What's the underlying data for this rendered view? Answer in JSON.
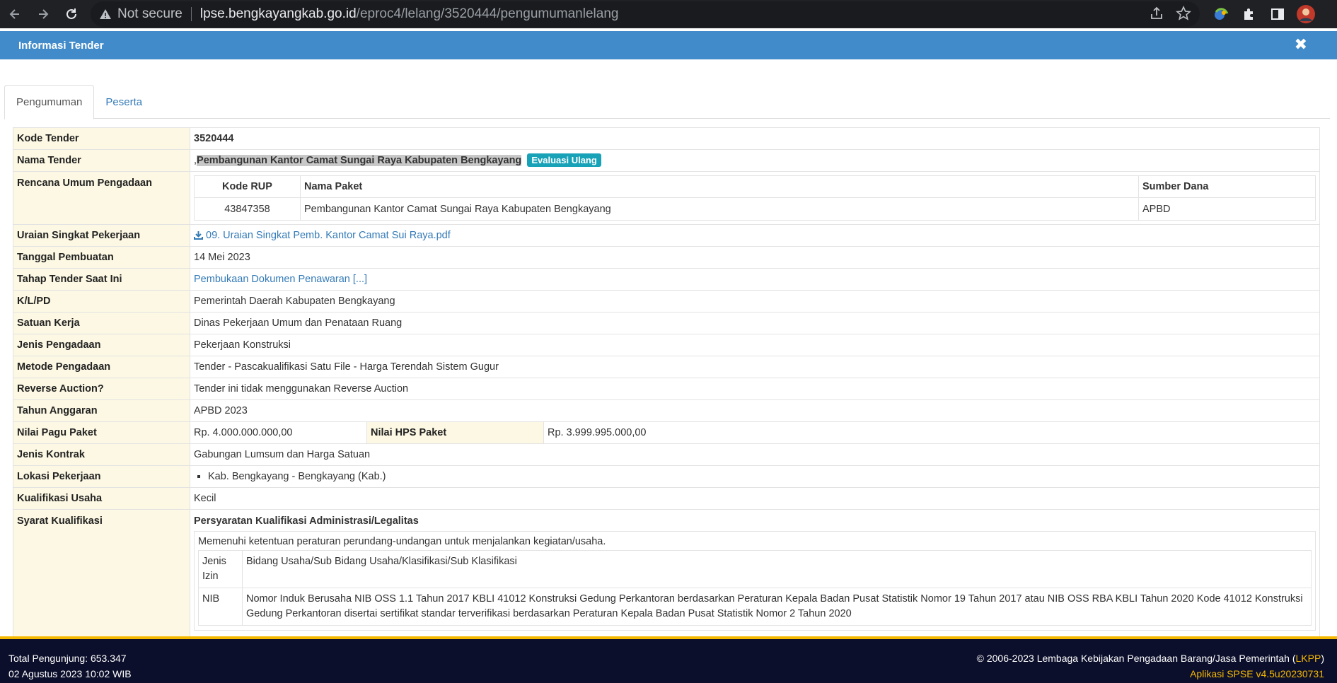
{
  "browser": {
    "security_label": "Not secure",
    "url_host": "lpse.bengkayangkab.go.id",
    "url_path": "/eproc4/lelang/3520444/pengumumanlelang"
  },
  "modal": {
    "title": "Informasi Tender",
    "close_symbol": "✖"
  },
  "tabs": [
    {
      "label": "Pengumuman",
      "active": true
    },
    {
      "label": "Peserta",
      "active": false
    }
  ],
  "rows": {
    "kode_tender": {
      "label": "Kode Tender",
      "value": "3520444"
    },
    "nama_tender": {
      "label": "Nama Tender",
      "prefix": ",",
      "value": "Pembangunan Kantor Camat Sungai Raya Kabupaten Bengkayang",
      "badge": "Evaluasi Ulang"
    },
    "rup": {
      "label": "Rencana Umum Pengadaan",
      "headers": [
        "Kode RUP",
        "Nama Paket",
        "Sumber Dana"
      ],
      "items": [
        {
          "kode": "43847358",
          "nama": "Pembangunan Kantor Camat Sungai Raya Kabupaten Bengkayang",
          "sumber": "APBD"
        }
      ]
    },
    "uraian": {
      "label": "Uraian Singkat Pekerjaan",
      "file": "09. Uraian Singkat Pemb. Kantor Camat Sui Raya.pdf"
    },
    "tanggal": {
      "label": "Tanggal Pembuatan",
      "value": "14 Mei 2023"
    },
    "tahap": {
      "label": "Tahap Tender Saat Ini",
      "value": "Pembukaan Dokumen Penawaran [...]"
    },
    "klpd": {
      "label": "K/L/PD",
      "value": "Pemerintah Daerah Kabupaten Bengkayang"
    },
    "satker": {
      "label": "Satuan Kerja",
      "value": "Dinas Pekerjaan Umum dan Penataan Ruang"
    },
    "jenis": {
      "label": "Jenis Pengadaan",
      "value": "Pekerjaan Konstruksi"
    },
    "metode": {
      "label": "Metode Pengadaan",
      "value": "Tender - Pascakualifikasi Satu File - Harga Terendah Sistem Gugur"
    },
    "reverse": {
      "label": "Reverse Auction?",
      "value": "Tender ini tidak menggunakan Reverse Auction"
    },
    "tahun": {
      "label": "Tahun Anggaran",
      "value": "APBD 2023"
    },
    "pagu": {
      "label": "Nilai Pagu Paket",
      "value": "Rp. 4.000.000.000,00",
      "hps_label": "Nilai HPS Paket",
      "hps_value": "Rp. 3.999.995.000,00"
    },
    "kontrak": {
      "label": "Jenis Kontrak",
      "value": "Gabungan Lumsum dan Harga Satuan"
    },
    "lokasi": {
      "label": "Lokasi Pekerjaan",
      "items": [
        "Kab. Bengkayang - Bengkayang (Kab.)"
      ]
    },
    "kualifikasi": {
      "label": "Kualifikasi Usaha",
      "value": "Kecil"
    },
    "syarat": {
      "label": "Syarat Kualifikasi",
      "section_title": "Persyaratan Kualifikasi Administrasi/Legalitas",
      "description": "Memenuhi ketentuan peraturan perundang-undangan untuk menjalankan kegiatan/usaha.",
      "izin_header": {
        "jenis": "Jenis Izin",
        "bidang": "Bidang Usaha/Sub Bidang Usaha/Klasifikasi/Sub Klasifikasi"
      },
      "izin_rows": [
        {
          "jenis": "NIB",
          "bidang": "Nomor Induk Berusaha NIB OSS 1.1 Tahun 2017 KBLI 41012 Konstruksi Gedung Perkantoran berdasarkan Peraturan Kepala Badan Pusat Statistik Nomor 19 Tahun 2017 atau NIB OSS RBA KBLI Tahun 2020 Kode 41012 Konstruksi Gedung Perkantoran disertai sertifikat standar terverifikasi berdasarkan Peraturan Kepala Badan Pusat Statistik Nomor 2 Tahun 2020"
        }
      ]
    }
  },
  "footer": {
    "visitors": "Total Pengunjung: 653.347",
    "datetime": "02 Agustus 2023 10:02 WIB",
    "copyright_prefix": "© 2006-2023 Lembaga Kebijakan Pengadaan Barang/Jasa Pemerintah (",
    "copyright_link": "LKPP",
    "copyright_suffix": ")",
    "app_version": "Aplikasi SPSE v4.5u20230731"
  },
  "colors": {
    "header_blue": "#428bca",
    "label_bg": "#fcf8e3",
    "badge": "#17a2b8",
    "footer_bg": "#0c0f2b",
    "footer_accent": "#f5b800"
  }
}
